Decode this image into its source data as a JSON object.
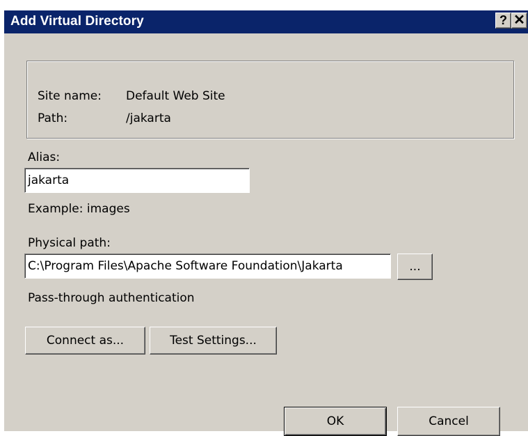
{
  "dialog": {
    "title": "Add Virtual Directory",
    "help_glyph": "?",
    "close_glyph": "✕"
  },
  "info": {
    "site_label": "Site name:",
    "site_value": "Default Web Site",
    "path_label": "Path:",
    "path_value": "/jakarta"
  },
  "alias": {
    "label": "Alias:",
    "value": "jakarta",
    "example": "Example: images"
  },
  "physical_path": {
    "label": "Physical path:",
    "value": "C:\\Program Files\\Apache Software Foundation\\Jakarta",
    "browse_label": "..."
  },
  "auth": {
    "label": "Pass-through authentication"
  },
  "buttons": {
    "connect_as": "Connect as...",
    "test_settings": "Test Settings...",
    "ok": "OK",
    "cancel": "Cancel"
  },
  "colors": {
    "titlebar": "#0a246a",
    "face": "#d4d0c8"
  },
  "icons": {
    "help": "help-icon",
    "close": "close-icon"
  }
}
